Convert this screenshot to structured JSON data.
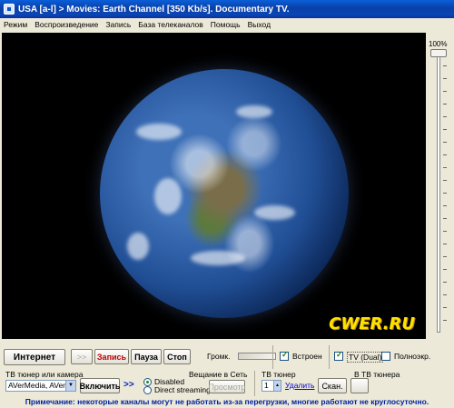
{
  "window": {
    "title": "USA [a-l] > Movies: Earth Channel [350 Kb/s]. Documentary TV."
  },
  "menu": [
    "Режим",
    "Воспроизведение",
    "Запись",
    "База телеканалов",
    "Помощь",
    "Выход"
  ],
  "video": {
    "watermark": "CWER.RU"
  },
  "volume_slider": {
    "label": "100%",
    "level": 1.0
  },
  "toolbar": {
    "internet": "Интернет",
    "forward": ">>",
    "record": "Запись",
    "pause": "Пауза",
    "stop": "Стоп",
    "volume_label": "Громк.",
    "embedded": "Встроен",
    "embedded_checked": true,
    "tv_dual": "TV (Dual)",
    "tv_dual_checked": true,
    "fullscreen": "Полноэкр.",
    "fullscreen_checked": false
  },
  "tuner": {
    "group_label": "ТВ тюнер или камера",
    "device_value": "AVerMedia, AVerT",
    "enable_button": "Включить",
    "forward": ">>"
  },
  "network": {
    "group_label": "Вещание в Сеть",
    "disabled_label": "Disabled",
    "direct_label": "Direct streaming",
    "selected": "Disabled",
    "preview_button": "Просмотр"
  },
  "tv_tuner": {
    "group_label": "ТВ тюнер",
    "channel_value": "1",
    "delete_link": "Удалить",
    "scan_button": "Скан."
  },
  "tuner_extra": {
    "group_label": "В ТВ тюнера"
  },
  "notice": "Примечание: некоторые каналы могут не работать из-за перегрузки, многие работают не круглосуточно."
}
